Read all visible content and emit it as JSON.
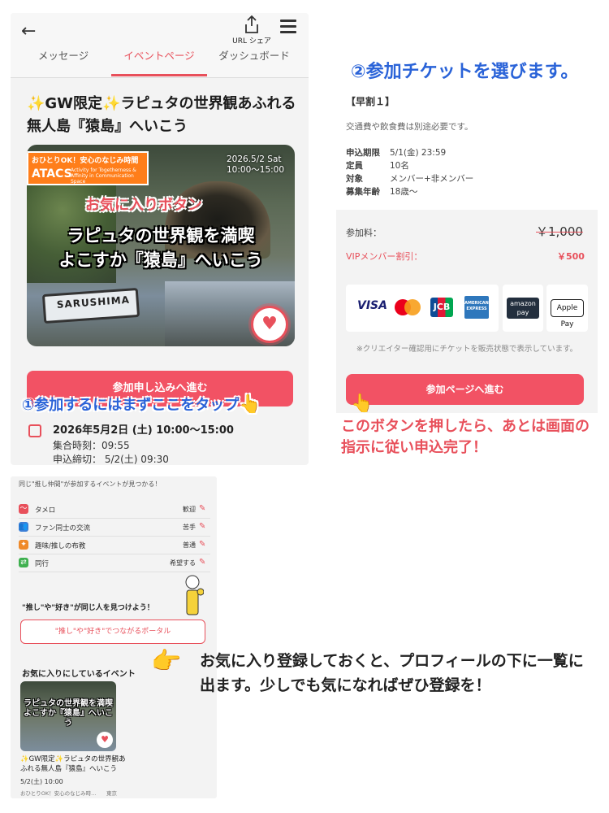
{
  "event_screen": {
    "share_label": "URL シェア",
    "tabs": [
      "メッセージ",
      "イベントページ",
      "ダッシュボード"
    ],
    "title": "✨GW限定✨ラピュタの世界観あふれる無人島『猿島』へいこう",
    "hero": {
      "badge_top": "おひとりOK！安心のなじみ時間",
      "badge_main": "ATACS",
      "badge_sub": "Activity for Togetherness & Affinity in Communication Space",
      "date_line1": "2026.5/2 Sat",
      "date_line2": "10:00〜15:00",
      "title_line1": "ラピュタの世界観を満喫",
      "title_line2": "よこすか『猿島』へいこう",
      "sign_text": "SARUSHIMA"
    },
    "favorite_callout": "お気に入りボタン",
    "apply_button": "参加申し込みへ進む",
    "step1_callout": "①参加するにはまずここをタップ",
    "date_main": "2026年5月2日 (土) 10:00〜15:00",
    "meet_time": "集合時刻：09:55",
    "deadline": "申込締切： 5/2(土) 09:30"
  },
  "ticket_screen": {
    "step2_heading": "②参加チケットを選びます。",
    "ticket_name": "【早割１】",
    "note": "交通費や飲食費は別途必要です。",
    "details": [
      {
        "label": "申込期限",
        "value": "5/1(金) 23:59"
      },
      {
        "label": "定員",
        "value": "10名"
      },
      {
        "label": "対象",
        "value": "メンバー+非メンバー"
      },
      {
        "label": "募集年齢",
        "value": "18歳〜"
      }
    ],
    "fee_label": "参加料：",
    "fee_price": "￥1,000",
    "vip_label": "VIPメンバー割引：",
    "vip_amount": "￥500",
    "payment_logos": [
      "VISA",
      "mastercard",
      "JCB",
      "AMERICAN EXPRESS",
      "amazon pay",
      "Apple Pay"
    ],
    "creator_note": "※クリエイター確認用にチケットを販売状態で表示しています。",
    "proceed_button": "参加ページへ進む",
    "step3_callout": "このボタンを押したら、あとは画面の指示に従い申込完了！"
  },
  "profile_screen": {
    "intro": "同じ\"推し仲間\"が参加するイベントが見つかる！",
    "preferences": [
      {
        "label": "タメロ",
        "value": "歓迎",
        "icon": "wave-icon",
        "color": "#e8505b"
      },
      {
        "label": "ファン同士の交流",
        "value": "苦手",
        "icon": "people-icon",
        "color": "#3b7fd6"
      },
      {
        "label": "趣味/推しの布教",
        "value": "普通",
        "icon": "megaphone-icon",
        "color": "#ef8a2a"
      },
      {
        "label": "同行",
        "value": "希望する",
        "icon": "together-icon",
        "color": "#3fb04f"
      }
    ],
    "portal_question": "\"推し\"や\"好き\"が同じ人を見つけよう！",
    "portal_button": "\"推し\"や\"好き\"でつながるポータル",
    "fav_events_title": "お気に入りにしているイベント",
    "fav_event_thumb_title": "ラピュタの世界観を満喫 よこすか『猿島』へいこう",
    "fav_event_name": "✨GW限定✨ラピュタの世界観あふれる無人島『猿島』へいこう",
    "fav_event_date": "5/2(土) 10:00",
    "fav_event_host": "おひとりOK！安心のなじみ時...",
    "fav_event_place": "東京"
  },
  "callout_4": "お気に入り登録しておくと、プロフィールの下に一覧に出ます。少しでも気になればぜひ登録を！",
  "colors": {
    "accent": "#f25264",
    "blue_callout": "#2a63d8",
    "red_text": "#e8505b"
  }
}
